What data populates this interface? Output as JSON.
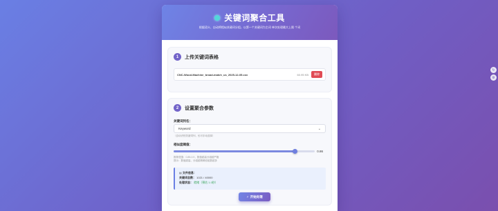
{
  "header": {
    "title": "关键词聚合工具",
    "subtitle_a": "根据语义、自动将相似关键词分组，以第一个关键词为主词",
    "subtitle_b": "单次处理最大上限",
    "subtitle_c": "个词"
  },
  "section1": {
    "number": "1",
    "title": "上传关键词表格",
    "file_name": "CNC-Wood-Machine_broad-match_us_2025-12-05.csv",
    "file_size": "60.95 KB",
    "delete_label": "删除"
  },
  "section2": {
    "number": "2",
    "title": "设置聚合参数",
    "keyword_col_label": "关键词列名：",
    "keyword_col_value": "Keyword",
    "keyword_col_hint": "（自动识别关键词列，也可手动选择）",
    "similarity_label": "相似度阈值：",
    "similarity_value": "0.86",
    "similarity_fraction": 0.86,
    "similarity_hint1": "推荐范围：0.85-0.9，数值越高分组越严格",
    "similarity_hint2": "提示：数值越高，分组越精确但组数越多",
    "file_info_title": "文件信息：",
    "keyword_count_label": "关键词总数：",
    "keyword_count_value": "1021 / 40000",
    "status_label": "处理状态：",
    "status_value": "就绪（预估 1.0秒）",
    "start_label": "开始处理"
  },
  "colors": {
    "accent": "#7364c9",
    "danger": "#e04b55",
    "success": "#3aa55b"
  }
}
